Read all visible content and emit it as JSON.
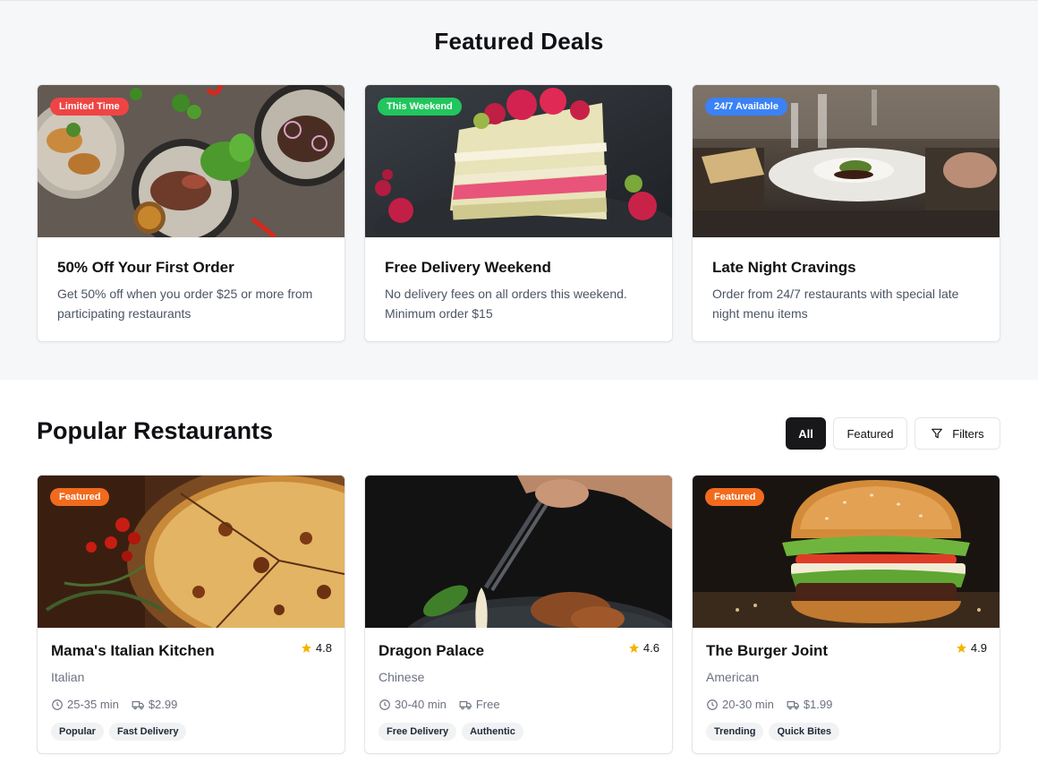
{
  "featured": {
    "title": "Featured Deals",
    "deals": [
      {
        "badge": "Limited Time",
        "badge_color": "#ef4444",
        "title": "50% Off Your First Order",
        "description": "Get 50% off when you order $25 or more from participating restaurants"
      },
      {
        "badge": "This Weekend",
        "badge_color": "#22c55e",
        "title": "Free Delivery Weekend",
        "description": "No delivery fees on all orders this weekend. Minimum order $15"
      },
      {
        "badge": "24/7 Available",
        "badge_color": "#3b82f6",
        "title": "Late Night Cravings",
        "description": "Order from 24/7 restaurants with special late night menu items"
      }
    ]
  },
  "popular": {
    "title": "Popular Restaurants",
    "filters": {
      "all": "All",
      "featured": "Featured",
      "filters": "Filters"
    },
    "restaurants": [
      {
        "badge": "Featured",
        "name": "Mama's Italian Kitchen",
        "rating": "4.8",
        "cuisine": "Italian",
        "time": "25-35 min",
        "fee": "$2.99",
        "tags": [
          "Popular",
          "Fast Delivery"
        ]
      },
      {
        "badge": "",
        "name": "Dragon Palace",
        "rating": "4.6",
        "cuisine": "Chinese",
        "time": "30-40 min",
        "fee": "Free",
        "tags": [
          "Free Delivery",
          "Authentic"
        ]
      },
      {
        "badge": "Featured",
        "name": "The Burger Joint",
        "rating": "4.9",
        "cuisine": "American",
        "time": "20-30 min",
        "fee": "$1.99",
        "tags": [
          "Trending",
          "Quick Bites"
        ]
      }
    ]
  },
  "colors": {
    "accent_orange": "#f26b1d",
    "star": "#f5b400",
    "dark_button": "#18181b"
  }
}
